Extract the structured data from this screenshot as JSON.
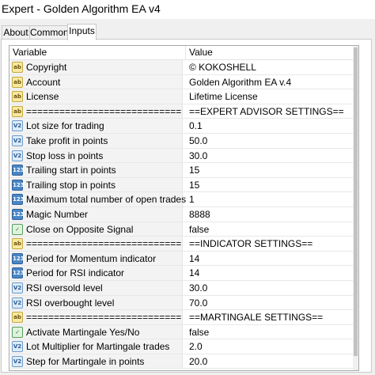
{
  "window": {
    "title": "Expert - Golden Algorithm EA v4"
  },
  "tabs": [
    "About",
    "Common",
    "Inputs"
  ],
  "table": {
    "headers": [
      "Variable",
      "Value"
    ],
    "rows": [
      {
        "icon": "ab",
        "label": "Copyright",
        "value": "© KOKOSHELL"
      },
      {
        "icon": "ab",
        "label": "Account",
        "value": "Golden Algorithm EA v.4"
      },
      {
        "icon": "ab",
        "label": "License",
        "value": "Lifetime License"
      },
      {
        "icon": "ab",
        "label": "============================",
        "value": "==EXPERT ADVISOR SETTINGS=="
      },
      {
        "icon": "v2",
        "label": "Lot size for trading",
        "value": "0.1"
      },
      {
        "icon": "v2",
        "label": "Take profit in points",
        "value": "50.0"
      },
      {
        "icon": "v2",
        "label": "Stop loss in points",
        "value": "30.0"
      },
      {
        "icon": "num",
        "label": "Trailing start in points",
        "value": "15"
      },
      {
        "icon": "num",
        "label": "Trailing stop in points",
        "value": "15"
      },
      {
        "icon": "num",
        "label": "Maximum total number of open trades",
        "value": "1"
      },
      {
        "icon": "num",
        "label": "Magic Number",
        "value": "8888"
      },
      {
        "icon": "bool",
        "label": "Close on Opposite Signal",
        "value": "false"
      },
      {
        "icon": "ab",
        "label": "============================",
        "value": "==INDICATOR SETTINGS=="
      },
      {
        "icon": "num",
        "label": "Period for Momentum indicator",
        "value": "14"
      },
      {
        "icon": "num",
        "label": "Period for RSI indicator",
        "value": "14"
      },
      {
        "icon": "v2",
        "label": "RSI oversold level",
        "value": "30.0"
      },
      {
        "icon": "v2",
        "label": "RSI overbought level",
        "value": "70.0"
      },
      {
        "icon": "ab",
        "label": "============================",
        "value": "==MARTINGALE SETTINGS=="
      },
      {
        "icon": "bool",
        "label": "Activate Martingale Yes/No",
        "value": "false"
      },
      {
        "icon": "v2",
        "label": "Lot Multiplier for Martingale trades",
        "value": "2.0"
      },
      {
        "icon": "v2",
        "label": "Step for Martingale in points",
        "value": "20.0"
      }
    ]
  },
  "icon_types": {
    "ab": {
      "text": "ab",
      "name": "string-type-icon"
    },
    "v2": {
      "text": "V2",
      "name": "double-type-icon"
    },
    "num": {
      "text": "123",
      "name": "integer-type-icon"
    },
    "bool": {
      "text": "✓",
      "name": "boolean-type-icon"
    }
  }
}
